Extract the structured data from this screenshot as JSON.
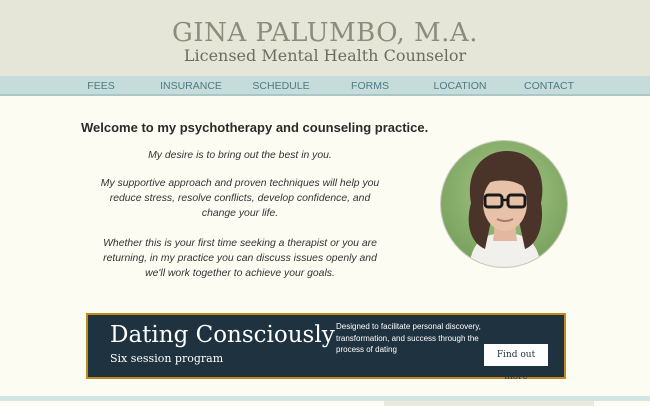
{
  "header": {
    "name": "GINA PALUMBO, M.A.",
    "tagline": "Licensed Mental Health Counselor"
  },
  "nav": {
    "items": [
      "FEES",
      "INSURANCE",
      "SCHEDULE",
      "FORMS",
      "LOCATION",
      "CONTACT"
    ]
  },
  "main": {
    "welcome": "Welcome to my psychotherapy and counseling practice.",
    "paragraphs": [
      "My desire is to bring out the best in you.",
      "My supportive approach and proven techniques will help you reduce stress, resolve conflicts, develop confidence, and change your life.",
      "Whether this is your first time seeking a therapist or you are returning, in my practice you can discuss issues openly and we'll work together to achieve your goals."
    ]
  },
  "banner": {
    "title": "Dating Consciously",
    "subtitle": "Six session program",
    "description": "Designed to facilitate personal discovery, transformation, and success through the process of dating",
    "cta": "Find out more"
  },
  "colors": {
    "background": "#fdfcf3",
    "header_bg": "#e6e6d8",
    "nav_bg": "#c5dcdb",
    "nav_text": "#4d7a84",
    "banner_bg": "#1f3240",
    "banner_border": "#c2891e"
  }
}
